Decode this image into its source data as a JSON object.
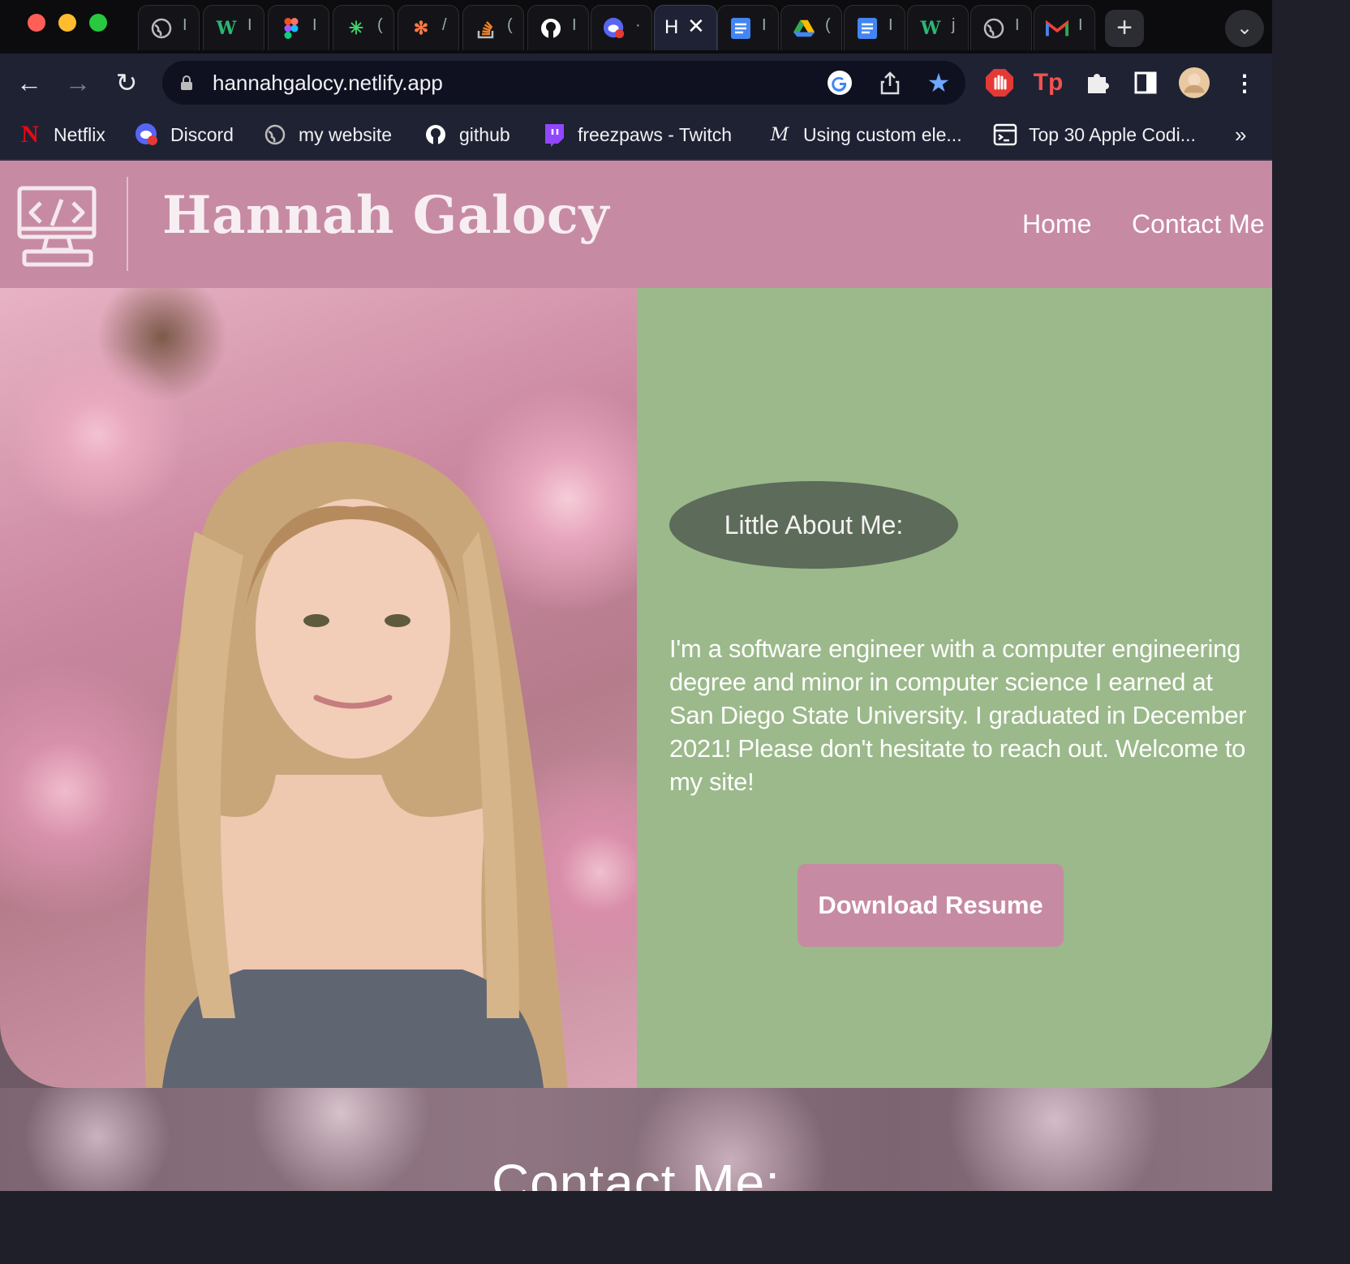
{
  "browser": {
    "tabs": [
      {
        "icon": "globe-icon",
        "fragment": "I"
      },
      {
        "icon": "w3schools-icon",
        "fragment": "I"
      },
      {
        "icon": "figma-icon",
        "fragment": "I"
      },
      {
        "icon": "spark-icon",
        "fragment": "("
      },
      {
        "icon": "asterisk-icon",
        "fragment": "/"
      },
      {
        "icon": "stackoverflow-icon",
        "fragment": "("
      },
      {
        "icon": "github-icon",
        "fragment": "I"
      },
      {
        "icon": "discord-icon",
        "fragment": "·"
      },
      {
        "icon": "page-icon",
        "fragment": "H",
        "active": true
      },
      {
        "icon": "docs-icon",
        "fragment": "I"
      },
      {
        "icon": "drive-icon",
        "fragment": "("
      },
      {
        "icon": "docs-icon",
        "fragment": "I"
      },
      {
        "icon": "w3schools-icon",
        "fragment": "j"
      },
      {
        "icon": "globe-icon",
        "fragment": "I"
      },
      {
        "icon": "gmail-icon",
        "fragment": "I"
      }
    ],
    "new_tab": "+",
    "url": "hannahgalocy.netlify.app",
    "bookmarks": [
      {
        "icon": "netflix-icon",
        "label": "Netflix"
      },
      {
        "icon": "discord-icon",
        "label": "Discord"
      },
      {
        "icon": "globe-icon",
        "label": "my website"
      },
      {
        "icon": "github-icon",
        "label": "github"
      },
      {
        "icon": "twitch-icon",
        "label": "freezpaws - Twitch"
      },
      {
        "icon": "medium-icon",
        "label": "Using custom ele..."
      },
      {
        "icon": "terminal-icon",
        "label": "Top 30 Apple Codi..."
      }
    ],
    "bookmarks_overflow": "»"
  },
  "site": {
    "title": "Hannah Galocy",
    "nav": {
      "home": "Home",
      "contact": "Contact Me"
    },
    "about": {
      "heading": "Little About Me:",
      "body": "I'm a software engineer with a computer engineering degree and minor in computer science I earned at San Diego State University. I graduated in December 2021! Please don't hesitate to reach out. Welcome to my site!",
      "resume_button": "Download Resume"
    },
    "contact_heading": "Contact Me:"
  },
  "colors": {
    "header_pink": "#c78aa3",
    "about_green": "#9bb98a",
    "pill_dark_green": "#5d6b5b"
  }
}
